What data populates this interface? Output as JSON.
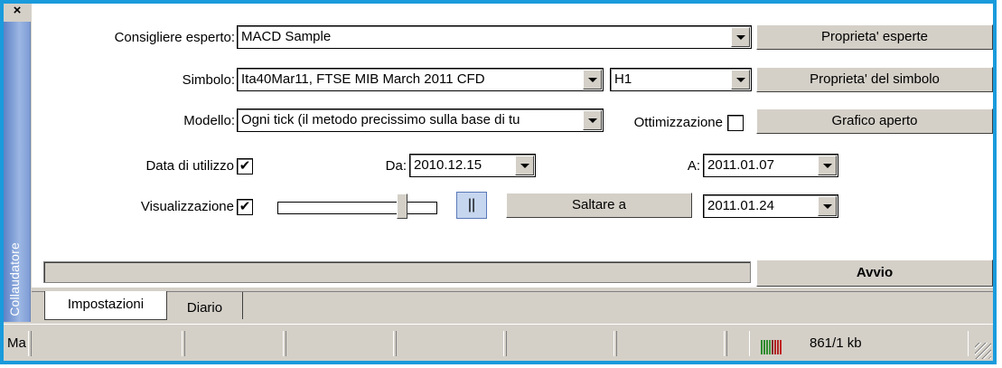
{
  "sidebar": {
    "close_glyph": "×",
    "title": "Collaudatore"
  },
  "form": {
    "expert_label": "Consigliere esperto:",
    "expert_value": "MACD Sample",
    "expert_props_button": "Proprieta' esperte",
    "symbol_label": "Simbolo:",
    "symbol_value": "Ita40Mar11, FTSE MIB March 2011 CFD",
    "period_value": "H1",
    "symbol_props_button": "Proprieta' del simbolo",
    "model_label": "Modello:",
    "model_value": "Ogni tick (il metodo precissimo sulla base di tu",
    "optimization_label": "Ottimizzazione",
    "optimization_checked": false,
    "open_chart_button": "Grafico aperto",
    "use_date_label": "Data di utilizzo",
    "use_date_checked": true,
    "from_label": "Da:",
    "from_value": "2010.12.15",
    "to_label": "A:",
    "to_value": "2011.01.07",
    "visual_label": "Visualizzazione",
    "visual_checked": true,
    "pause_glyph": "||",
    "skip_button": "Saltare a",
    "skip_date_value": "2011.01.24",
    "start_button": "Avvio",
    "check_glyph": "✔"
  },
  "tabs": [
    {
      "label": "Impostazioni",
      "active": true
    },
    {
      "label": "Diario",
      "active": false
    }
  ],
  "statusbar": {
    "first_cell": "Ma",
    "traffic": "861/1 kb"
  },
  "colors": {
    "frame": "#1a9bdc",
    "face": "#d4d0c8",
    "pause_bg": "#c6d6ef"
  }
}
